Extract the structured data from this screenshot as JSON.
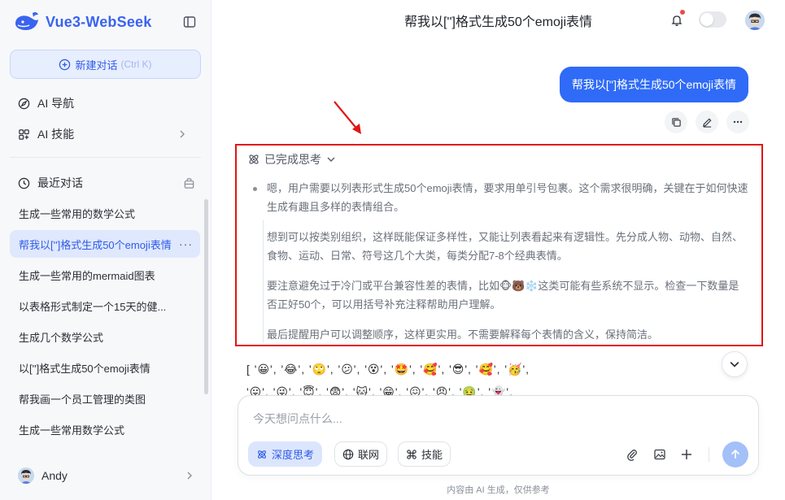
{
  "app": {
    "name": "Vue3-WebSeek",
    "brand_color": "#3a63f0"
  },
  "sidebar": {
    "new_chat_label": "新建对话",
    "new_chat_hint": "(Ctrl K)",
    "nav": [
      {
        "label": "AI 导航",
        "icon": "compass-icon"
      },
      {
        "label": "AI 技能",
        "icon": "apps-icon"
      }
    ],
    "recent_title": "最近对话",
    "history": [
      "生成一些常用的数学公式",
      "帮我以['']格式生成50个emoji表情",
      "生成一些常用的mermaid图表",
      "以表格形式制定一个15天的健...",
      "生成几个数学公式",
      "以['']格式生成50个emoji表情",
      "帮我画一个员工管理的类图",
      "生成一些常用数学公式"
    ],
    "user_name": "Andy"
  },
  "header": {
    "title": "帮我以['']格式生成50个emoji表情"
  },
  "conversation": {
    "user_message": "帮我以['']格式生成50个emoji表情",
    "thinking_label": "已完成思考",
    "thinking_paragraphs": [
      "嗯，用户需要以列表形式生成50个emoji表情，要求用单引号包裹。这个需求很明确，关键在于如何快速生成有趣且多样的表情组合。",
      "想到可以按类别组织，这样既能保证多样性，又能让列表看起来有逻辑性。先分成人物、动物、自然、食物、运动、日常、符号这几个大类，每类分配7-8个经典表情。",
      "要注意避免过于冷门或平台兼容性差的表情，比如🐵🐻❄️这类可能有些系统不显示。检查一下数量是否正好50个，可以用括号补充注释帮助用户理解。",
      "最后提醒用户可以调整顺序，这样更实用。不需要解释每个表情的含义，保持简洁。"
    ],
    "answer_rows": [
      "[ '😀', '😂', '🙄', '😕', '😵', '🤩', '🥰', '😎', '🥰', '🥳',",
      "  '😛', '😜', '😇', '😨', '🐱', '😁', '😖', '😠', '🤢', '👻',"
    ]
  },
  "composer": {
    "placeholder": "今天想问点什么...",
    "chips": [
      "深度思考",
      "联网",
      "技能"
    ]
  },
  "disclaimer": "内容由 AI 生成，仅供参考"
}
